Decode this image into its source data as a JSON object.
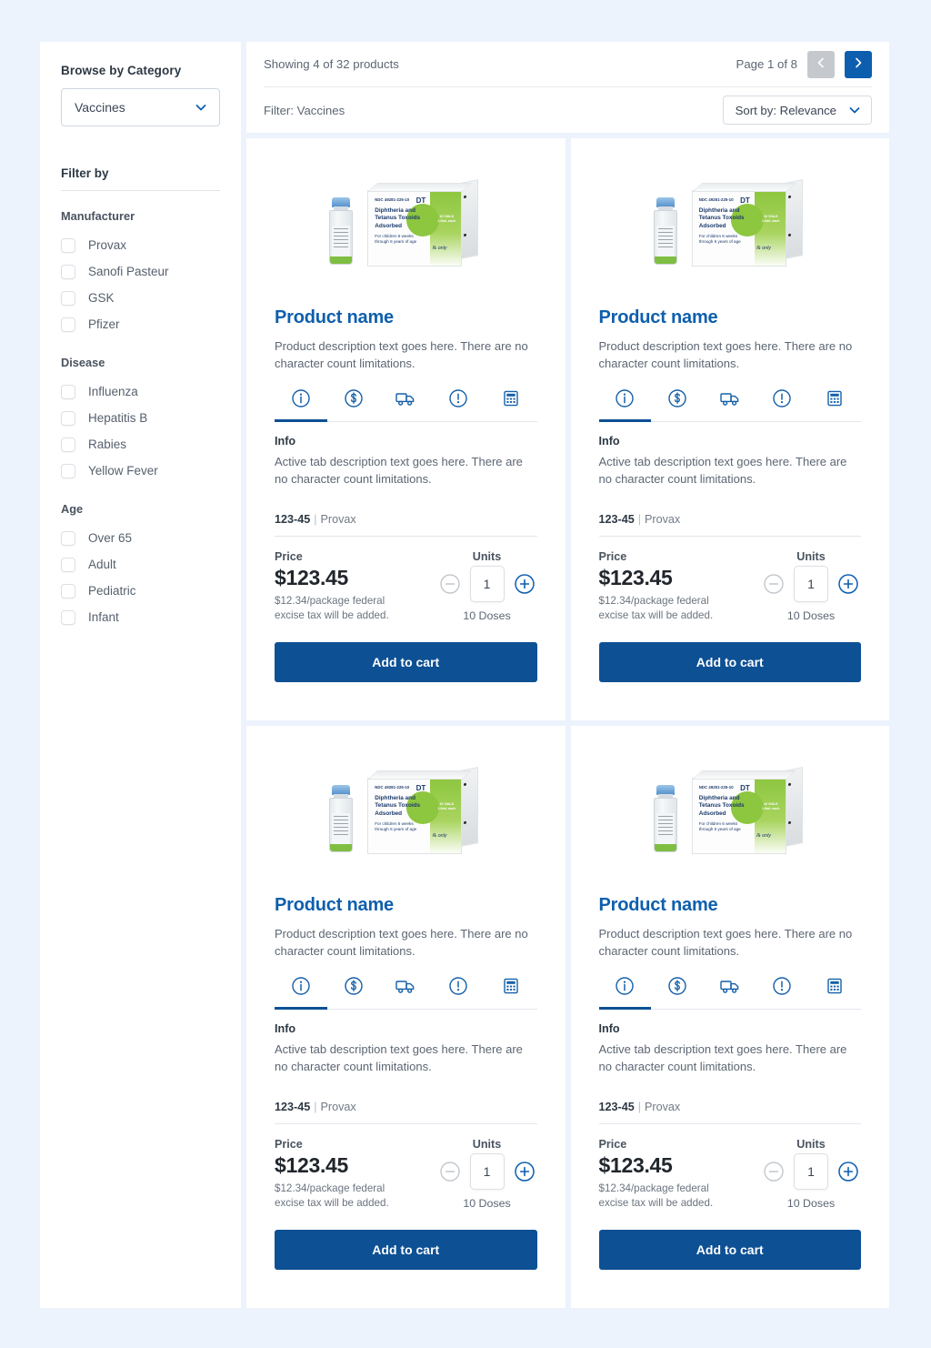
{
  "sidebar": {
    "browse_title": "Browse by Category",
    "category_value": "Vaccines",
    "filter_by": "Filter by",
    "groups": [
      {
        "title": "Manufacturer",
        "options": [
          "Provax",
          "Sanofi Pasteur",
          "GSK",
          "Pfizer"
        ]
      },
      {
        "title": "Disease",
        "options": [
          "Influenza",
          "Hepatitis B",
          "Rabies",
          "Yellow Fever"
        ]
      },
      {
        "title": "Age",
        "options": [
          "Over 65",
          "Adult",
          "Pediatric",
          "Infant"
        ]
      }
    ]
  },
  "toolbar": {
    "showing": "Showing 4 of  32 products",
    "page_label": "Page 1 of 8",
    "filter_text": "Filter: Vaccines",
    "sort_label": "Sort by: Relevance",
    "prev_icon": "chevron-left-icon",
    "next_icon": "chevron-right-icon"
  },
  "product_image": {
    "ndc": "NDC 49281-225-10",
    "dt": "DT",
    "name": "Diphtheria and Tetanus Toxoids Adsorbed",
    "sub": "For children 6 weeks through 6 years of age",
    "rx": "℞ only",
    "vials": "10 VIALS 1.0mL each"
  },
  "tab_icons": [
    "info-icon",
    "dollar-icon",
    "truck-icon",
    "alert-icon",
    "calculator-icon"
  ],
  "card": {
    "name": "Product name",
    "description": "Product description text goes here. There are no character count limitations.",
    "tab_title": "Info",
    "tab_body": "Active tab description text goes here. There are no character count limitations.",
    "sku": "123-45",
    "separator": "|",
    "manufacturer": "Provax",
    "price_label": "Price",
    "price": "$123.45",
    "tax_note": "$12.34/package federal excise tax will be added.",
    "units_label": "Units",
    "quantity": "1",
    "doses": "10 Doses",
    "add_to_cart": "Add to cart",
    "minus_icon": "minus-circle-icon",
    "plus_icon": "plus-circle-icon"
  },
  "cards": [
    {
      "index": 1
    },
    {
      "index": 2
    },
    {
      "index": 3
    },
    {
      "index": 4
    }
  ],
  "colors": {
    "background": "#edf3fc",
    "primary": "#0d5094",
    "accent": "#0e5fad",
    "disabled": "#c5c9ce"
  }
}
